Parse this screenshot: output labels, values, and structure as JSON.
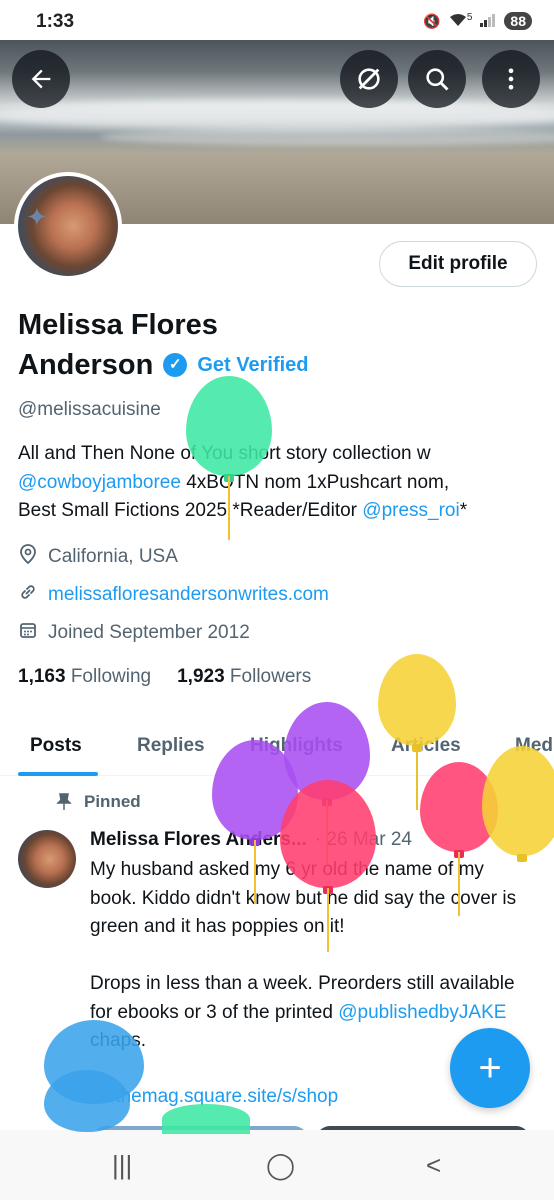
{
  "status_bar": {
    "time": "1:33",
    "signal_label": "5",
    "battery": "88"
  },
  "profile": {
    "name_line1": "Melissa Flores",
    "name_line2": "Anderson",
    "get_verified": "Get Verified",
    "handle": "@melissacuisine",
    "edit_profile": "Edit profile",
    "bio": {
      "line1": "All and Then None of You short story collection w",
      "mention1": "@cowboyjamboree",
      "line2_rest": " 4xBOTN nom 1xPushcart nom,",
      "line3": "Best Small Fictions 2025 *Reader/Editor ",
      "mention2": "@press_roi",
      "line3_end": "*"
    },
    "location": "California, USA",
    "website": "melissafloresandersonwrites.com",
    "joined": "Joined September 2012",
    "following_count": "1,163",
    "following_label": "Following",
    "followers_count": "1,923",
    "followers_label": "Followers"
  },
  "tabs": [
    {
      "label": "Posts"
    },
    {
      "label": "Replies"
    },
    {
      "label": "Highlights"
    },
    {
      "label": "Articles"
    },
    {
      "label": "Med"
    }
  ],
  "pinned_post": {
    "pinned_label": "Pinned",
    "author": "Melissa Flores Anders...",
    "date": "· 26 Mar 24",
    "text_p1": "My husband asked my 6 yr old the name of my book. Kiddo didn't know but he did say the cover is green and it has poppies on it!",
    "text_p2_start": "Drops in less than a week. Preorders still available for ebooks or 3 of the printed ",
    "text_p2_mention": "@publishedbyJAKE",
    "text_p2_end": " chaps.",
    "link": "...sthemag.square.site/s/shop"
  },
  "fab": {
    "icon": "+"
  },
  "nav": {
    "recents": "|||",
    "home": "◯",
    "back": "<"
  },
  "colors": {
    "accent": "#1d9bf0",
    "text": "#0f1419",
    "muted": "#536471"
  }
}
